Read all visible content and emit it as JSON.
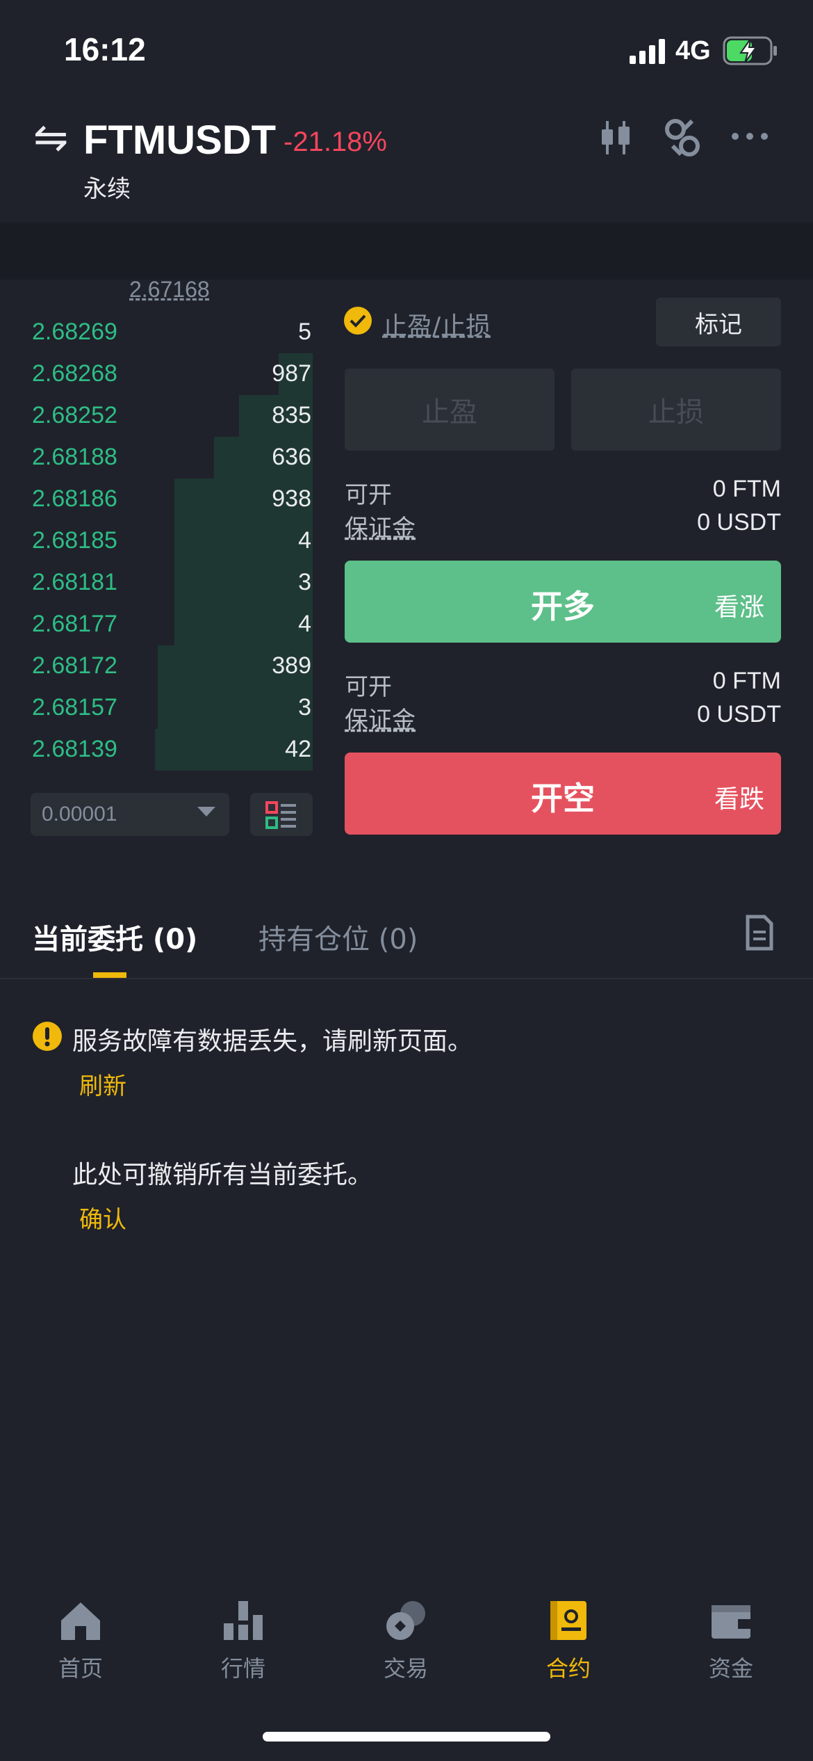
{
  "status_bar": {
    "time": "16:12",
    "network": "4G"
  },
  "header": {
    "symbol": "FTMUSDT",
    "change": "-21.18%",
    "contract_type": "永续"
  },
  "order_book": {
    "mid_price": "2.67168",
    "rows": [
      {
        "price": "2.68269",
        "qty": "5",
        "depth": 0.0
      },
      {
        "price": "2.68268",
        "qty": "987",
        "depth": 0.12
      },
      {
        "price": "2.68252",
        "qty": "835",
        "depth": 0.26
      },
      {
        "price": "2.68188",
        "qty": "636",
        "depth": 0.35
      },
      {
        "price": "2.68186",
        "qty": "938",
        "depth": 0.49
      },
      {
        "price": "2.68185",
        "qty": "4",
        "depth": 0.49
      },
      {
        "price": "2.68181",
        "qty": "3",
        "depth": 0.49
      },
      {
        "price": "2.68177",
        "qty": "4",
        "depth": 0.49
      },
      {
        "price": "2.68172",
        "qty": "389",
        "depth": 0.55
      },
      {
        "price": "2.68157",
        "qty": "3",
        "depth": 0.55
      },
      {
        "price": "2.68139",
        "qty": "42",
        "depth": 0.56
      }
    ],
    "precision": "0.00001"
  },
  "panel": {
    "tpsl_label": "止盈/止损",
    "mark_label": "标记",
    "take_profit": "止盈",
    "stop_loss": "止损",
    "long_block": {
      "open_label": "可开",
      "open_value": "0 FTM",
      "margin_label": "保证金",
      "margin_value": "0 USDT"
    },
    "short_block": {
      "open_label": "可开",
      "open_value": "0 FTM",
      "margin_label": "保证金",
      "margin_value": "0 USDT"
    },
    "long_button": {
      "label": "开多",
      "sub": "看涨",
      "color": "#5dbf89"
    },
    "short_button": {
      "label": "开空",
      "sub": "看跌",
      "color": "#e5525f"
    }
  },
  "tabs": {
    "open_orders": "当前委托 (0)",
    "positions": "持有仓位 (0)"
  },
  "messages": {
    "error": "服务故障有数据丢失，请刷新页面。",
    "refresh": "刷新",
    "cancel_hint": "此处可撤销所有当前委托。",
    "confirm": "确认"
  },
  "nav": {
    "items": [
      {
        "label": "首页",
        "icon": "home-icon"
      },
      {
        "label": "行情",
        "icon": "markets-icon"
      },
      {
        "label": "交易",
        "icon": "trade-icon"
      },
      {
        "label": "合约",
        "icon": "futures-icon",
        "active": true
      },
      {
        "label": "资金",
        "icon": "wallet-icon"
      }
    ]
  },
  "colors": {
    "accent": "#f0b90b",
    "up": "#2ebd85",
    "down": "#f6465d",
    "bg": "#1f222b"
  }
}
